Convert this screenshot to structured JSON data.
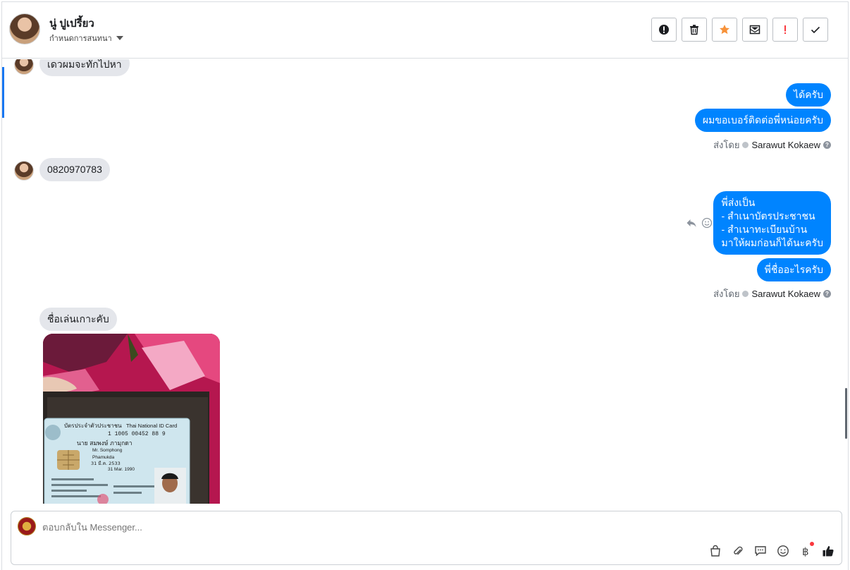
{
  "header": {
    "contact_name": "นู่ ปูเปรี้ยว",
    "assign_label": "กำหนดการสนทนา",
    "actions": [
      {
        "name": "report-spam",
        "icon": "alert-circle-icon"
      },
      {
        "name": "delete",
        "icon": "trash-icon"
      },
      {
        "name": "star",
        "icon": "star-icon"
      },
      {
        "name": "mark-unread",
        "icon": "mail-icon"
      },
      {
        "name": "important",
        "icon": "exclamation-icon"
      },
      {
        "name": "done",
        "icon": "check-icon"
      }
    ]
  },
  "messages": {
    "m1": "เดวผมจะทักไปหา",
    "m2": "ได้ครับ",
    "m3": "ผมขอเบอร์ติดต่อพี่หน่อยครับ",
    "sent_by_1_prefix": "ส่งโดย",
    "sent_by_1_name": "Sarawut Kokaew",
    "m4": "0820970783",
    "m5": "พี่ส่งเป็น\n- สำเนาบัตรประชาชน\n- สำเนาทะเบียนบ้าน\nมาให้ผมก่อนก็ได้นะครับ",
    "m6": "พี่ชื่ออะไรครับ",
    "sent_by_2_prefix": "ส่งโดย",
    "sent_by_2_name": "Sarawut Kokaew",
    "m7": "ชื่อเล่นเกาะคับ"
  },
  "id_card": {
    "title_th": "บัตรประจำตัวประชาชน",
    "title_en": "Thai National ID Card",
    "id_number": "1 1005 00452 88 9",
    "name_th": "นาย สมพงษ์  ภามุกดา",
    "name_en": "Mr. Somphong",
    "last_name_en": "Phamukda",
    "dob_th": "31 มี.ค. 2533",
    "dob_en": "31 Mar. 1990"
  },
  "composer": {
    "placeholder": "ตอบกลับใน Messenger..."
  },
  "colors": {
    "outgoing_bubble": "#0084ff",
    "incoming_bubble": "#e4e6eb",
    "star": "#f7923a",
    "important": "#fa383e"
  }
}
